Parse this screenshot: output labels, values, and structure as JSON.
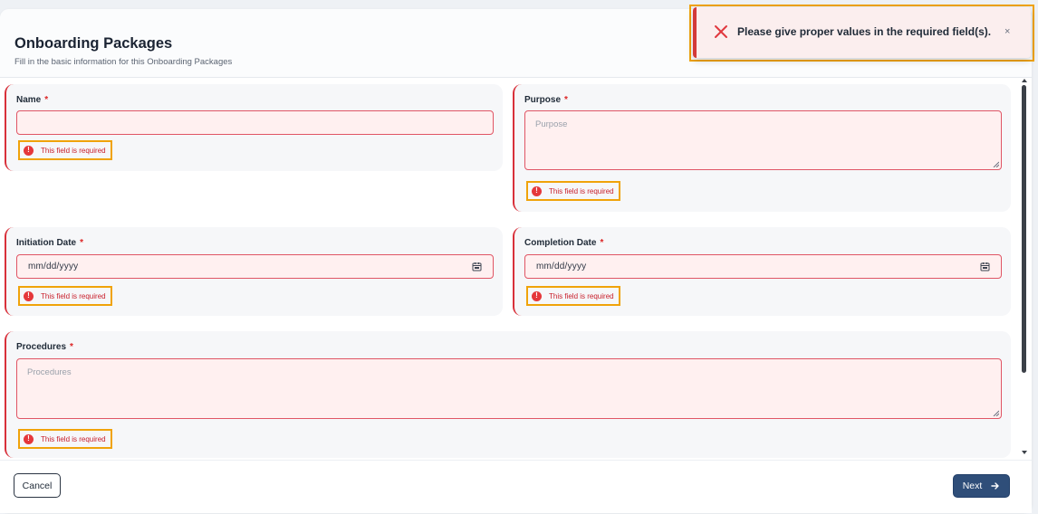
{
  "header": {
    "title": "Onboarding Packages",
    "subtitle": "Fill in the basic information for this Onboarding Packages"
  },
  "fields": {
    "name": {
      "label": "Name",
      "required_mark": "*",
      "value": "",
      "error": "This field is required"
    },
    "purpose": {
      "label": "Purpose",
      "required_mark": "*",
      "placeholder": "Purpose",
      "error": "This field is required"
    },
    "initiation_date": {
      "label": "Initiation Date",
      "required_mark": "*",
      "value": "mm/dd/yyyy",
      "error": "This field is required"
    },
    "completion_date": {
      "label": "Completion Date",
      "required_mark": "*",
      "value": "mm/dd/yyyy",
      "error": "This field is required"
    },
    "procedures": {
      "label": "Procedures",
      "required_mark": "*",
      "placeholder": "Procedures",
      "error": "This field is required"
    }
  },
  "error_icon_glyph": "!",
  "footer": {
    "cancel_label": "Cancel",
    "next_label": "Next",
    "next_icon": "arrow-right-icon"
  },
  "toast": {
    "message": "Please give proper values in the required field(s).",
    "close_glyph": "×",
    "icon": "error-x-icon"
  },
  "colors": {
    "error_red": "#dc2626",
    "primary_button": "#2f4e79",
    "highlight_outline": "#f0a30a",
    "field_error_bg": "#fff0f0"
  }
}
